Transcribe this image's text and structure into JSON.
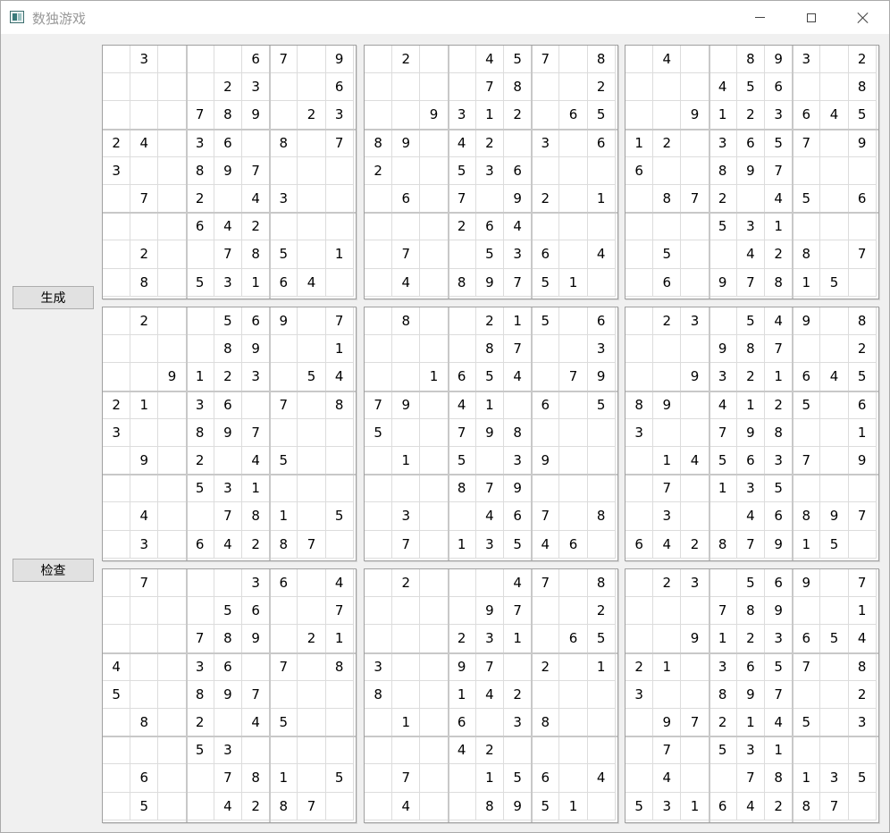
{
  "window": {
    "title": "数独游戏"
  },
  "buttons": {
    "generate": "生成",
    "check": "检查"
  },
  "boards": [
    [
      [
        "",
        "3",
        "",
        "",
        "",
        "6",
        "7",
        "",
        "9"
      ],
      [
        "",
        "",
        "",
        "",
        "2",
        "3",
        "",
        "",
        "6"
      ],
      [
        "",
        "",
        "",
        "7",
        "8",
        "9",
        "",
        "2",
        "3"
      ],
      [
        "2",
        "4",
        "",
        "3",
        "6",
        "",
        "8",
        "",
        "7"
      ],
      [
        "3",
        "",
        "",
        "8",
        "9",
        "7",
        "",
        "",
        ""
      ],
      [
        "",
        "7",
        "",
        "2",
        "",
        "4",
        "3",
        "",
        ""
      ],
      [
        "",
        "",
        "",
        "6",
        "4",
        "2",
        "",
        "",
        ""
      ],
      [
        "",
        "2",
        "",
        "",
        "7",
        "8",
        "5",
        "",
        "1"
      ],
      [
        "",
        "8",
        "",
        "5",
        "3",
        "1",
        "6",
        "4",
        ""
      ]
    ],
    [
      [
        "",
        "2",
        "",
        "",
        "4",
        "5",
        "7",
        "",
        "8"
      ],
      [
        "",
        "",
        "",
        "",
        "7",
        "8",
        "",
        "",
        "2"
      ],
      [
        "",
        "",
        "9",
        "3",
        "1",
        "2",
        "",
        "6",
        "5"
      ],
      [
        "8",
        "9",
        "",
        "4",
        "2",
        "",
        "3",
        "",
        "6"
      ],
      [
        "2",
        "",
        "",
        "5",
        "3",
        "6",
        "",
        "",
        ""
      ],
      [
        "",
        "6",
        "",
        "7",
        "",
        "9",
        "2",
        "",
        "1"
      ],
      [
        "",
        "",
        "",
        "2",
        "6",
        "4",
        "",
        "",
        ""
      ],
      [
        "",
        "7",
        "",
        "",
        "5",
        "3",
        "6",
        "",
        "4"
      ],
      [
        "",
        "4",
        "",
        "8",
        "9",
        "7",
        "5",
        "1",
        ""
      ]
    ],
    [
      [
        "",
        "4",
        "",
        "",
        "8",
        "9",
        "3",
        "",
        "2"
      ],
      [
        "",
        "",
        "",
        "4",
        "5",
        "6",
        "",
        "",
        "8"
      ],
      [
        "",
        "",
        "9",
        "1",
        "2",
        "3",
        "6",
        "4",
        "5"
      ],
      [
        "1",
        "2",
        "",
        "3",
        "6",
        "5",
        "7",
        "",
        "9"
      ],
      [
        "6",
        "",
        "",
        "8",
        "9",
        "7",
        "",
        "",
        ""
      ],
      [
        "",
        "8",
        "7",
        "2",
        "",
        "4",
        "5",
        "",
        "6"
      ],
      [
        "",
        "",
        "",
        "5",
        "3",
        "1",
        "",
        "",
        ""
      ],
      [
        "",
        "5",
        "",
        "",
        "4",
        "2",
        "8",
        "",
        "7"
      ],
      [
        "",
        "6",
        "",
        "9",
        "7",
        "8",
        "1",
        "5",
        ""
      ]
    ],
    [
      [
        "",
        "2",
        "",
        "",
        "5",
        "6",
        "9",
        "",
        "7"
      ],
      [
        "",
        "",
        "",
        "",
        "8",
        "9",
        "",
        "",
        "1"
      ],
      [
        "",
        "",
        "9",
        "1",
        "2",
        "3",
        "",
        "5",
        "4"
      ],
      [
        "2",
        "1",
        "",
        "3",
        "6",
        "",
        "7",
        "",
        "8"
      ],
      [
        "3",
        "",
        "",
        "8",
        "9",
        "7",
        "",
        "",
        ""
      ],
      [
        "",
        "9",
        "",
        "2",
        "",
        "4",
        "5",
        "",
        ""
      ],
      [
        "",
        "",
        "",
        "5",
        "3",
        "1",
        "",
        "",
        ""
      ],
      [
        "",
        "4",
        "",
        "",
        "7",
        "8",
        "1",
        "",
        "5"
      ],
      [
        "",
        "3",
        "",
        "6",
        "4",
        "2",
        "8",
        "7",
        ""
      ]
    ],
    [
      [
        "",
        "8",
        "",
        "",
        "2",
        "1",
        "5",
        "",
        "6"
      ],
      [
        "",
        "",
        "",
        "",
        "8",
        "7",
        "",
        "",
        "3"
      ],
      [
        "",
        "",
        "1",
        "6",
        "5",
        "4",
        "",
        "7",
        "9"
      ],
      [
        "7",
        "9",
        "",
        "4",
        "1",
        "",
        "6",
        "",
        "5"
      ],
      [
        "5",
        "",
        "",
        "7",
        "9",
        "8",
        "",
        "",
        ""
      ],
      [
        "",
        "1",
        "",
        "5",
        "",
        "3",
        "9",
        "",
        ""
      ],
      [
        "",
        "",
        "",
        "8",
        "7",
        "9",
        "",
        "",
        ""
      ],
      [
        "",
        "3",
        "",
        "",
        "4",
        "6",
        "7",
        "",
        "8"
      ],
      [
        "",
        "7",
        "",
        "1",
        "3",
        "5",
        "4",
        "6",
        ""
      ]
    ],
    [
      [
        "",
        "2",
        "3",
        "",
        "5",
        "4",
        "9",
        "",
        "8"
      ],
      [
        "",
        "",
        "",
        "9",
        "8",
        "7",
        "",
        "",
        "2"
      ],
      [
        "",
        "",
        "9",
        "3",
        "2",
        "1",
        "6",
        "4",
        "5"
      ],
      [
        "8",
        "9",
        "",
        "4",
        "1",
        "2",
        "5",
        "",
        "6"
      ],
      [
        "3",
        "",
        "",
        "7",
        "9",
        "8",
        "",
        "",
        "1"
      ],
      [
        "",
        "1",
        "4",
        "5",
        "6",
        "3",
        "7",
        "",
        "9"
      ],
      [
        "",
        "7",
        "",
        "1",
        "3",
        "5",
        "",
        "",
        ""
      ],
      [
        "",
        "3",
        "",
        "",
        "4",
        "6",
        "8",
        "9",
        "7"
      ],
      [
        "6",
        "4",
        "2",
        "8",
        "7",
        "9",
        "1",
        "5",
        ""
      ]
    ],
    [
      [
        "",
        "7",
        "",
        "",
        "",
        "3",
        "6",
        "",
        "4"
      ],
      [
        "",
        "",
        "",
        "",
        "5",
        "6",
        "",
        "",
        "7"
      ],
      [
        "",
        "",
        "",
        "7",
        "8",
        "9",
        "",
        "2",
        "1"
      ],
      [
        "4",
        "",
        "",
        "3",
        "6",
        "",
        "7",
        "",
        "8"
      ],
      [
        "5",
        "",
        "",
        "8",
        "9",
        "7",
        "",
        "",
        ""
      ],
      [
        "",
        "8",
        "",
        "2",
        "",
        "4",
        "5",
        "",
        ""
      ],
      [
        "",
        "",
        "",
        "5",
        "3",
        "",
        "",
        "",
        ""
      ],
      [
        "",
        "6",
        "",
        "",
        "7",
        "8",
        "1",
        "",
        "5"
      ],
      [
        "",
        "5",
        "",
        "",
        "4",
        "2",
        "8",
        "7",
        ""
      ]
    ],
    [
      [
        "",
        "2",
        "",
        "",
        "",
        "4",
        "7",
        "",
        "8"
      ],
      [
        "",
        "",
        "",
        "",
        "9",
        "7",
        "",
        "",
        "2"
      ],
      [
        "",
        "",
        "",
        "2",
        "3",
        "1",
        "",
        "6",
        "5"
      ],
      [
        "3",
        "",
        "",
        "9",
        "7",
        "",
        "2",
        "",
        "1"
      ],
      [
        "8",
        "",
        "",
        "1",
        "4",
        "2",
        "",
        "",
        ""
      ],
      [
        "",
        "1",
        "",
        "6",
        "",
        "3",
        "8",
        "",
        ""
      ],
      [
        "",
        "",
        "",
        "4",
        "2",
        "",
        "",
        "",
        ""
      ],
      [
        "",
        "7",
        "",
        "",
        "1",
        "5",
        "6",
        "",
        "4"
      ],
      [
        "",
        "4",
        "",
        "",
        "8",
        "9",
        "5",
        "1",
        ""
      ]
    ],
    [
      [
        "",
        "2",
        "3",
        "",
        "5",
        "6",
        "9",
        "",
        "7"
      ],
      [
        "",
        "",
        "",
        "7",
        "8",
        "9",
        "",
        "",
        "1"
      ],
      [
        "",
        "",
        "9",
        "1",
        "2",
        "3",
        "6",
        "5",
        "4"
      ],
      [
        "2",
        "1",
        "",
        "3",
        "6",
        "5",
        "7",
        "",
        "8"
      ],
      [
        "3",
        "",
        "",
        "8",
        "9",
        "7",
        "",
        "",
        "2"
      ],
      [
        "",
        "9",
        "7",
        "2",
        "1",
        "4",
        "5",
        "",
        "3"
      ],
      [
        "",
        "7",
        "",
        "5",
        "3",
        "1",
        "",
        "",
        ""
      ],
      [
        "",
        "4",
        "",
        "",
        "7",
        "8",
        "1",
        "3",
        "5"
      ],
      [
        "5",
        "3",
        "1",
        "6",
        "4",
        "2",
        "8",
        "7",
        ""
      ]
    ]
  ]
}
